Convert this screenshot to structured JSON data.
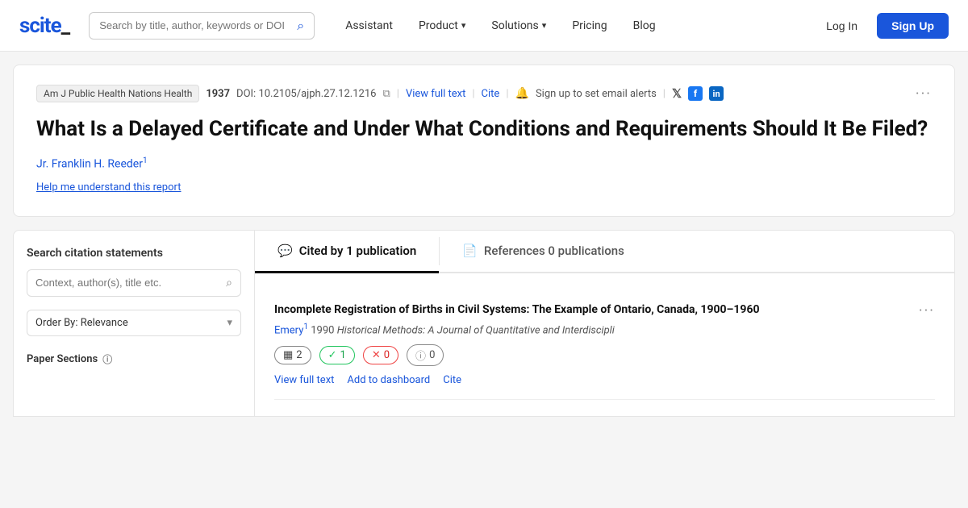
{
  "logo": {
    "text_blue": "scite",
    "text_dark": "_"
  },
  "navbar": {
    "search_placeholder": "Search by title, author, keywords or DOI",
    "items": [
      {
        "label": "Assistant",
        "has_dropdown": false
      },
      {
        "label": "Product",
        "has_dropdown": true
      },
      {
        "label": "Solutions",
        "has_dropdown": true
      },
      {
        "label": "Pricing",
        "has_dropdown": false
      },
      {
        "label": "Blog",
        "has_dropdown": false
      }
    ],
    "login_label": "Log In",
    "signup_label": "Sign Up"
  },
  "article": {
    "journal": "Am J Public Health Nations Health",
    "year": "1937",
    "doi_label": "DOI:",
    "doi_value": "10.2105/ajph.27.12.1216",
    "view_full_text": "View full text",
    "cite": "Cite",
    "alert_text": "Sign up to set email alerts",
    "title": "What Is a Delayed Certificate and Under What Conditions and Requirements Should It Be Filed?",
    "author": "Jr. Franklin H. Reeder",
    "author_sup": "1",
    "help_link": "Help me understand this report",
    "more_dots": "···"
  },
  "sidebar": {
    "title": "Search citation statements",
    "search_placeholder": "Context, author(s), title etc.",
    "order_label": "Order By: Relevance",
    "sections_label": "Paper Sections"
  },
  "tabs": [
    {
      "id": "cited",
      "icon": "💬",
      "label": "Cited by 1 publication",
      "active": true
    },
    {
      "id": "references",
      "icon": "📄",
      "label": "References 0 publications",
      "active": false
    }
  ],
  "citations": [
    {
      "title": "Incomplete Registration of Births in Civil Systems: The Example of Ontario, Canada, 1900–1960",
      "author": "Emery",
      "author_sup": "1",
      "year": "1990",
      "journal": "Historical Methods: A Journal of Quantitative and Interdiscipli",
      "stats": {
        "total": "2",
        "supporting": "1",
        "contradicting": "0",
        "mentioning": "0"
      },
      "actions": {
        "view_full_text": "View full text",
        "add_to_dashboard": "Add to dashboard",
        "cite": "Cite"
      }
    }
  ]
}
